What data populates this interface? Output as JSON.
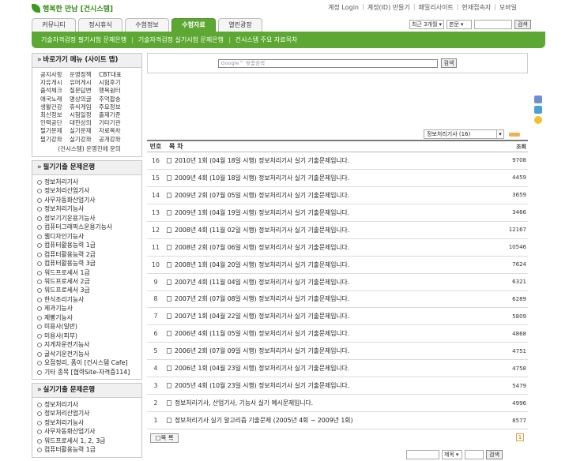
{
  "site": {
    "logo_text": "행복한 만남 [건시스템]"
  },
  "top_links": [
    "계정 Login",
    "계정(ID) 만들기",
    "패밀리사이트",
    "현재접속자",
    "모바일"
  ],
  "tabs": [
    "커뮤니티",
    "정시휴식",
    "수험정보",
    "수험자료",
    "열린광장"
  ],
  "top_search": {
    "period": "최근 3개월",
    "field": "본문",
    "button": "검색"
  },
  "sub_menu": [
    "기술자격검정 필기시험 문제은행",
    "기술자격검정 실기시험 문제은행",
    "건시스템 주요 자료목차"
  ],
  "shortcut_box": {
    "title": "바로가기 메뉴 (사이트 맵)",
    "grid": [
      [
        "공지사항",
        "운영정책",
        "CBT대표"
      ],
      [
        "자유게시",
        "유머게시",
        "시험후기"
      ],
      [
        "출석체크",
        "질문답변",
        "행복쉼터"
      ],
      [
        "애국노래",
        "명상의글",
        "추억팝송"
      ],
      [
        "생활건강",
        "휴식게임",
        "주요정보"
      ],
      [
        "최신정보",
        "시험일정",
        "출제기준"
      ],
      [
        "인력공단",
        "대한상의",
        "기타기관"
      ],
      [
        "필기문제",
        "실기문제",
        "자료목차"
      ],
      [
        "필기강좌",
        "실기강좌",
        "공개강좌"
      ]
    ],
    "footer": "(건시스템) 운영진에 문의"
  },
  "written_box": {
    "title": "필기기출 문제은행",
    "items": [
      "정보처리기사",
      "정보처리산업기사",
      "사무자동화산업기사",
      "정보처리기능사",
      "정보기기운용기능사",
      "컴퓨터그래픽스운용기능사",
      "웹디자인기능사",
      "컴퓨터활용능력 1급",
      "컴퓨터활용능력 2급",
      "컴퓨터활용능력 3급",
      "워드프로세서 1급",
      "워드프로세서 2급",
      "워드프로세서 3급",
      "한식조리기능사",
      "제과기능사",
      "제빵기능사",
      "미용사(일반)",
      "미용사(피부)",
      "지게차운전기능사",
      "굴삭기운전기능사",
      "요점정리, 폼이 [건시스템 Cafe]",
      "기타 종목 [협력Site-자격증114]"
    ]
  },
  "practical_box": {
    "title": "실기기출 문제은행",
    "items": [
      "정보처리기사",
      "정보처리산업기사",
      "정보처리기능사",
      "사무자동화산업기사",
      "워드프로세서 1, 2, 3급",
      "컴퓨터활용능력 1급"
    ]
  },
  "google_search": {
    "placeholder": "Google™ 맞춤검색",
    "button": "검색"
  },
  "filter": {
    "value": "정보처리기사 (16)"
  },
  "table": {
    "headers": {
      "no": "번호",
      "title": "목 차",
      "views": "조회"
    },
    "rows": [
      {
        "no": "16",
        "title": "2010년 1회 (04월 18일 시행) 정보처리기사 실기 기출문제입니다.",
        "views": "9708"
      },
      {
        "no": "15",
        "title": "2009년 4회 (10월 18일 시행) 정보처리기사 실기 기출문제입니다.",
        "views": "4459"
      },
      {
        "no": "14",
        "title": "2009년 2회 (07월 05일 시행) 정보처리기사 실기 기출문제입니다.",
        "views": "3659"
      },
      {
        "no": "13",
        "title": "2009년 1회 (04월 19일 시행) 정보처리기사 실기 기출문제입니다.",
        "views": "3466"
      },
      {
        "no": "12",
        "title": "2008년 4회 (11월 02일 시행) 정보처리기사 실기 기출문제입니다.",
        "views": "12167"
      },
      {
        "no": "11",
        "title": "2008년 2회 (07월 06일 시행) 정보처리기사 실기 기출문제입니다.",
        "views": "10546"
      },
      {
        "no": "10",
        "title": "2008년 1회 (04월 20일 시행) 정보처리기사 실기 기출문제입니다.",
        "views": "7624"
      },
      {
        "no": "9",
        "title": "2007년 4회 (11월 04일 시행) 정보처리기사 실기 기출문제입니다.",
        "views": "6321"
      },
      {
        "no": "8",
        "title": "2007년 2회 (07월 08일 시행) 정보처리기사 실기 기출문제입니다.",
        "views": "6289"
      },
      {
        "no": "7",
        "title": "2007년 1회 (04월 22일 시행) 정보처리기사 실기 기출문제입니다.",
        "views": "5809"
      },
      {
        "no": "6",
        "title": "2006년 4회 (11월 05일 시행) 정보처리기사 실기 기출문제입니다.",
        "views": "4868"
      },
      {
        "no": "5",
        "title": "2006년 2회 (07월 09일 시행) 정보처리기사 실기 기출문제입니다.",
        "views": "4751"
      },
      {
        "no": "4",
        "title": "2006년 1회 (04월 23일 시행) 정보처리기사 실기 기출문제입니다.",
        "views": "4758"
      },
      {
        "no": "3",
        "title": "2005년 4회 (10월 23일 시행) 정보처리기사 실기 기출문제입니다.",
        "views": "5479"
      },
      {
        "no": "2",
        "title": "정보처리기사, 산업기사, 기능사 실기 예시문제입니다.",
        "views": "4996"
      },
      {
        "no": "1",
        "title": "정보처리기사 실기 알고리즘 기출문제 (2005년 4회 ~ 2009년 1회)",
        "views": "8577"
      }
    ]
  },
  "list_button": "목 록",
  "page": "1",
  "bottom_search": {
    "field": "제목",
    "button": "검색"
  },
  "colors": {
    "accent": "#5ca832"
  }
}
